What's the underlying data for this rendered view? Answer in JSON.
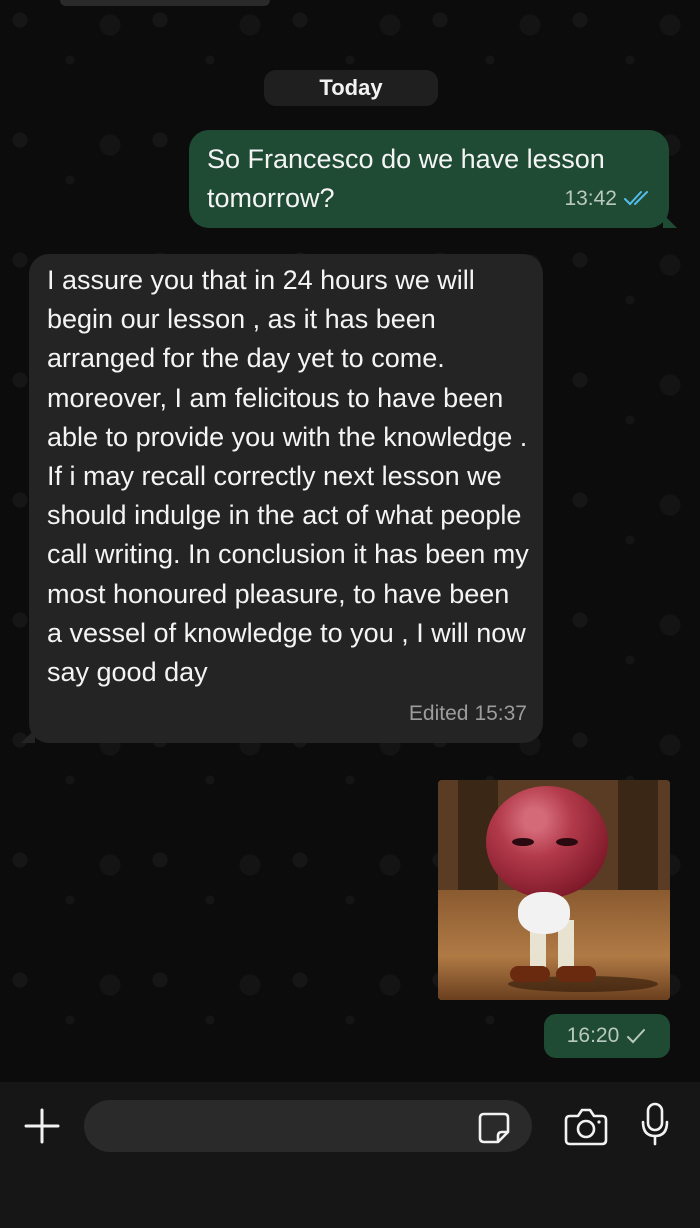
{
  "chat": {
    "date_label": "Today",
    "messages": [
      {
        "direction": "outgoing",
        "text": "So Francesco do we have lesson tomorrow?",
        "time": "13:42",
        "status_icon": "double-check-read-icon"
      },
      {
        "direction": "incoming",
        "text": "I assure you that in 24 hours we will begin our lesson , as it has been arranged for the day yet to come. moreover, I am felicitous to have been able to provide you with the knowledge . If i may recall correctly next lesson we should indulge in the act of what people call writing. In conclusion it has been my most honoured pleasure, to have been a vessel of knowledge to you , I will now say good day",
        "edited_label": "Edited",
        "time": "15:37"
      },
      {
        "direction": "outgoing",
        "type": "image",
        "image_description_icon": "apple-character-sticker-icon",
        "time": "16:20",
        "status_icon": "single-check-icon"
      }
    ]
  },
  "composer": {
    "plus_icon": "plus-icon",
    "input_value": "",
    "sticker_icon": "sticker-icon",
    "camera_icon": "camera-icon",
    "mic_icon": "microphone-icon"
  },
  "colors": {
    "outgoing_bubble": "#1f4a34",
    "incoming_bubble": "#242424",
    "read_check": "#53bdeb",
    "background": "#0c0c0c"
  }
}
